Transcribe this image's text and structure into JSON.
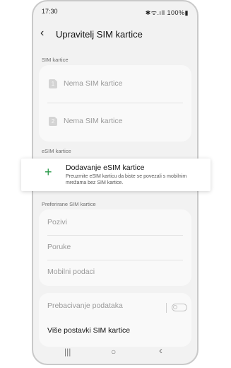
{
  "status_bar": {
    "time": "17:30",
    "icons": "✱ᯤ.ıll 100%▮"
  },
  "header": {
    "title": "Upravitelj SIM kartice"
  },
  "sim_section": {
    "label": "SIM kartice",
    "items": [
      {
        "badge": "1",
        "label": "Nema SIM kartice"
      },
      {
        "badge": "2",
        "label": "Nema SIM kartice"
      }
    ]
  },
  "esim_section": {
    "label": "eSIM kartice",
    "add": {
      "title": "Dodavanje eSIM kartice",
      "description": "Preuzmite eSIM karticu da biste se povezali s mobilnim mrežama bez SIM kartice."
    }
  },
  "preferred_section": {
    "label": "Preferirane SIM kartice",
    "items": [
      "Pozivi",
      "Poruke",
      "Mobilni podaci"
    ]
  },
  "more": {
    "data_switch_label": "Prebacivanje podataka",
    "data_switch_enabled": false,
    "more_settings_label": "Više postavki SIM kartice"
  },
  "nav": {
    "recents": "|||",
    "home": "○",
    "back": "‹"
  }
}
